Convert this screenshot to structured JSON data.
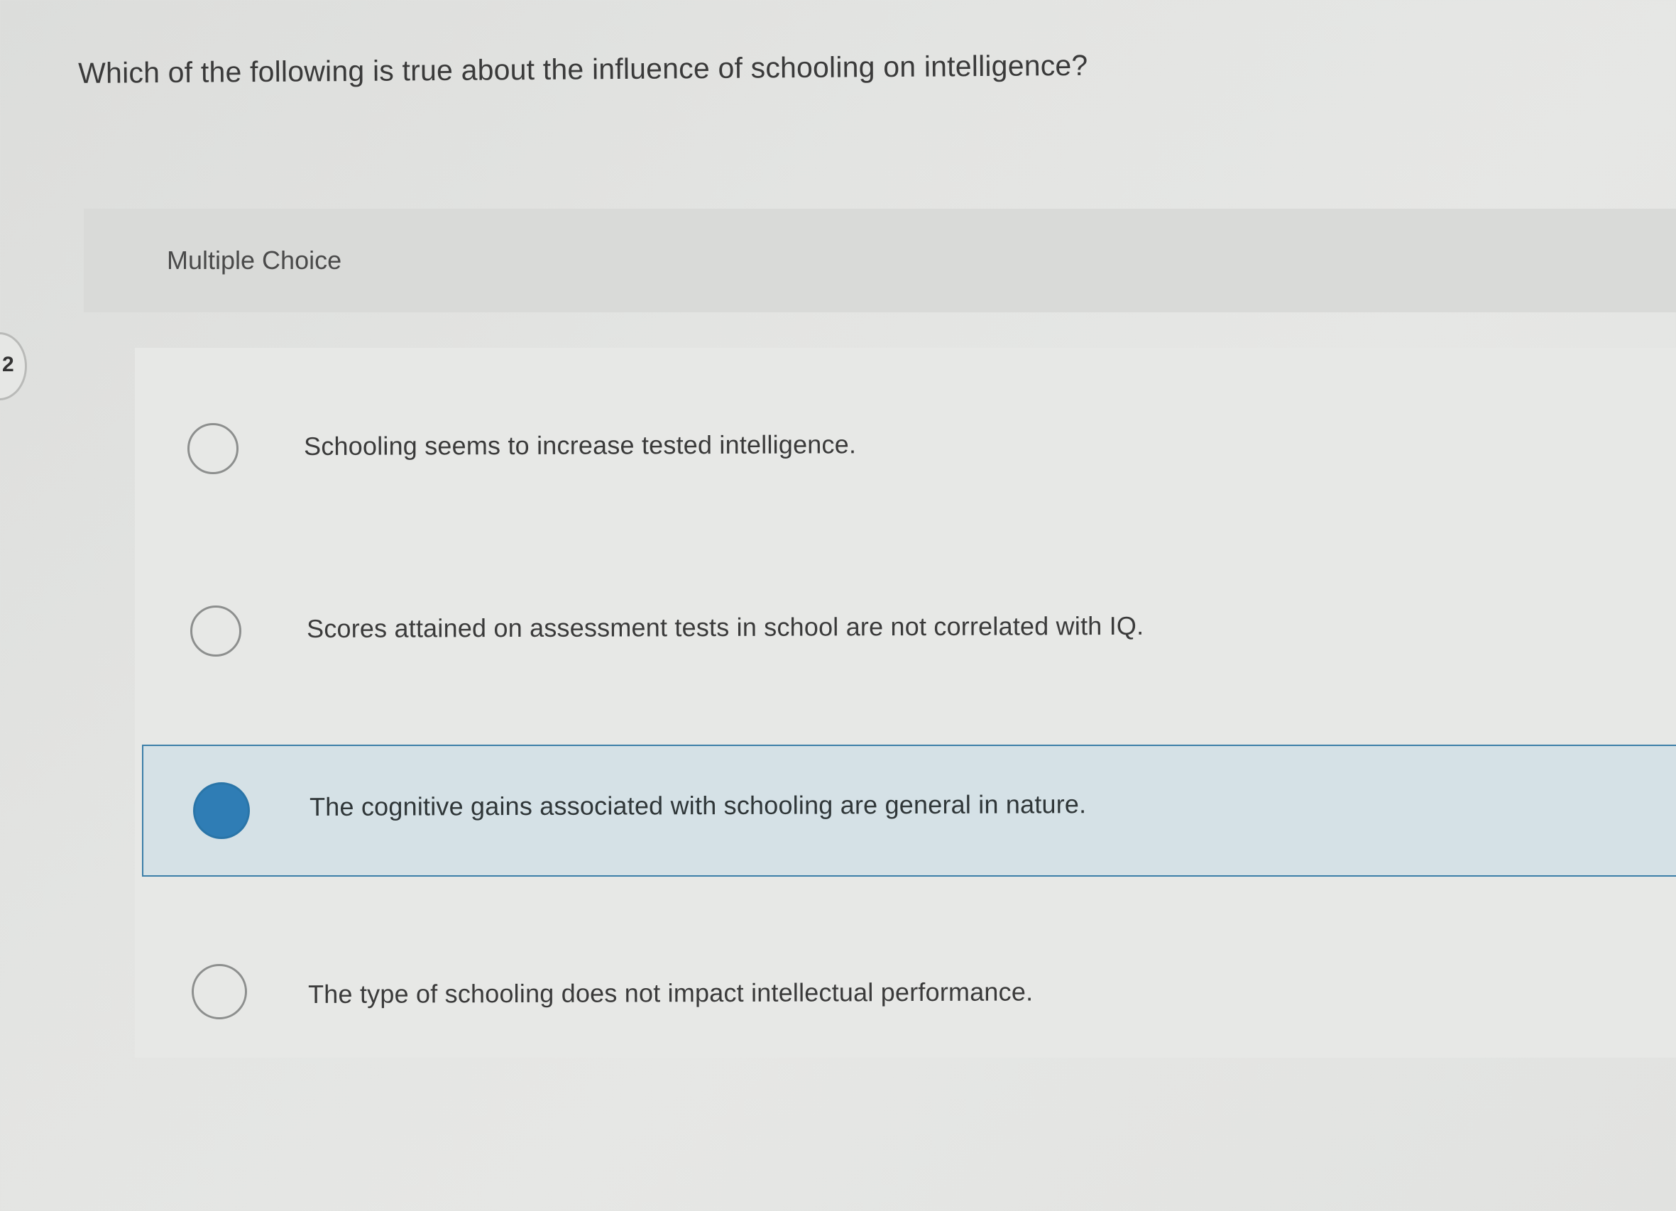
{
  "question": {
    "number": "2",
    "text": "Which of the following is true about the influence of schooling on intelligence?"
  },
  "question_type": "Multiple Choice",
  "options": [
    {
      "label": "Schooling seems to increase tested intelligence.",
      "selected": false
    },
    {
      "label": "Scores attained on assessment tests in school are not correlated with IQ.",
      "selected": false
    },
    {
      "label": "The cognitive gains associated with schooling are general in nature.",
      "selected": true
    },
    {
      "label": "The type of schooling does not impact intellectual performance.",
      "selected": false
    }
  ],
  "colors": {
    "selected_fill": "#2f7db5",
    "selected_background": "#d5e1e6",
    "selected_border": "#3b7ea8"
  }
}
